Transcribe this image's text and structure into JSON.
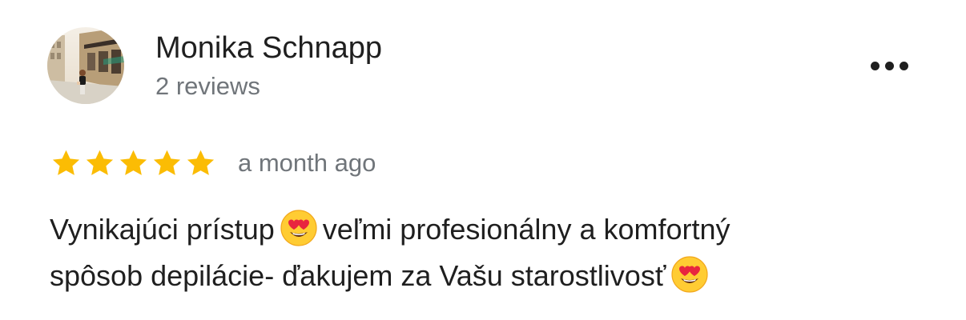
{
  "reviewer": {
    "name": "Monika Schnapp",
    "review_count": "2 reviews"
  },
  "more_icon": "more-horizontal-icon",
  "review": {
    "rating": 5,
    "rating_max": 5,
    "date": "a month ago",
    "text_line1_part1": "Vynikajúci prístup",
    "text_line1_part2": "veľmi profesionálny a komfortný",
    "text_line2": "spôsob depilácie- ďakujem za Vašu starostlivosť",
    "emoji": "heart-eyes-emoji"
  },
  "colors": {
    "star": "#fbbc04",
    "name": "#1f1f1f",
    "secondary": "#70757a"
  }
}
